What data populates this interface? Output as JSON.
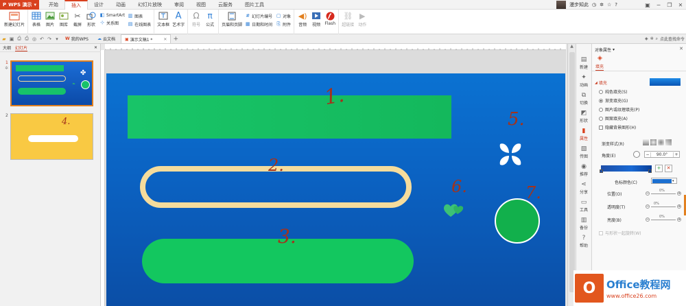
{
  "app": {
    "name": "WPS 演示"
  },
  "menu_tabs": [
    "开始",
    "插入",
    "设计",
    "动画",
    "幻灯片放映",
    "审阅",
    "视图",
    "云服务",
    "图片工具"
  ],
  "menu_active": "插入",
  "user": {
    "name": "漫步知此"
  },
  "ribbon": {
    "new_slide": "新建幻灯片",
    "table": "表格",
    "picture": "图片",
    "gallery": "图库",
    "screenshot": "截屏",
    "shape": "形状",
    "smartart": "SmartArt",
    "chart": "图表",
    "relation": "关系图",
    "online_chart": "在线图表",
    "textbox": "文本框",
    "wordart": "艺术字",
    "symbol": "符号",
    "formula": "公式",
    "header_footer": "页眉和页脚",
    "slide_number": "幻灯片编号",
    "object": "对象",
    "datetime": "日期和时间",
    "attachment": "附件",
    "audio": "音频",
    "video": "视频",
    "flash": "Flash",
    "hyperlink": "超链接",
    "action": "动作"
  },
  "doc_tabs": [
    {
      "label": "我的WPS"
    },
    {
      "label": "云文档"
    },
    {
      "label": "演示文稿1 *"
    }
  ],
  "search_cmd": "点此查找命令",
  "left_tabs": [
    "大纲",
    "幻灯片"
  ],
  "thumbnails": [
    {
      "num": "1",
      "annotation": ""
    },
    {
      "num": "2",
      "annotation": "4."
    }
  ],
  "slide_annotations": [
    "1.",
    "2.",
    "3.",
    "5.",
    "6.",
    "7."
  ],
  "side_buttons": [
    "新建",
    "动画",
    "切换",
    "形状",
    "属性",
    "传图",
    "推荐",
    "分享",
    "工具",
    "备份",
    "帮助"
  ],
  "side_active": "属性",
  "props": {
    "title": "对象属性",
    "tab": "填充",
    "section": "填充",
    "options": [
      {
        "label": "纯色填充(S)",
        "selected": false
      },
      {
        "label": "渐变填充(G)",
        "selected": true
      },
      {
        "label": "图片或纹理填充(P)",
        "selected": false
      },
      {
        "label": "图案填充(A)",
        "selected": false
      }
    ],
    "hide_bg": "隐藏背景图形(H)",
    "gradient_style": "渐变样式(R)",
    "angle_label": "角度(E)",
    "angle_value": "90.0°",
    "stop_color": "色标颜色(C)",
    "position": "位置(O)",
    "transparency": "透明度(T)",
    "brightness": "亮度(B)",
    "slider_value": "0%",
    "rotate_with_shape": "与形状一起旋转(W)"
  },
  "watermark": {
    "logo": "O",
    "title": "Office教程网",
    "url": "www.office26.com"
  },
  "colors": {
    "accent": "#d9411e",
    "slide_blue": "#0b68c8",
    "green": "#12c15c",
    "outline_yellow": "#f5dc9c"
  }
}
